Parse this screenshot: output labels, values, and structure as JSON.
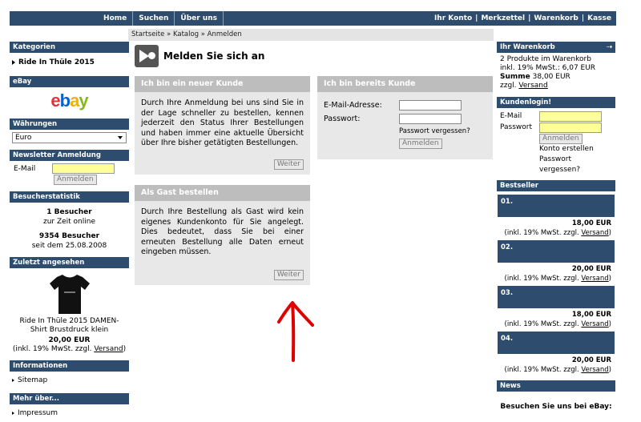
{
  "topnav": {
    "left": [
      "Home",
      "Suchen",
      "Über uns"
    ],
    "right": [
      "Ihr Konto",
      "Merkzettel",
      "Warenkorb",
      "Kasse"
    ]
  },
  "breadcrumb": "Startseite » Katalog » Anmelden",
  "left": {
    "kategorien": {
      "title": "Kategorien",
      "item": "Ride In Thüle 2015"
    },
    "ebay": {
      "title": "eBay",
      "logo": "ebay"
    },
    "waehrungen": {
      "title": "Währungen",
      "selected": "Euro"
    },
    "newsletter": {
      "title": "Newsletter Anmeldung",
      "email_label": "E-Mail",
      "button": "Anmelden"
    },
    "besucher": {
      "title": "Besucherstatistik",
      "online_count": "1 Besucher",
      "online_text": "zur Zeit online",
      "total_count": "9354 Besucher",
      "total_text": "seit dem 25.08.2008"
    },
    "zuletzt": {
      "title": "Zuletzt angesehen",
      "product_name": "Ride In Thüle 2015 DAMEN-Shirt Brustdruck klein",
      "price": "20,00 EUR",
      "tax_prefix": "(inkl. 19% MwSt. zzgl.",
      "tax_link": "Versand",
      "tax_suffix": ")"
    },
    "informationen": {
      "title": "Informationen",
      "item": "Sitemap"
    },
    "mehr": {
      "title": "Mehr über...",
      "item": "Impressum"
    }
  },
  "main": {
    "title": "Melden Sie sich an",
    "new_customer": {
      "title": "Ich bin ein neuer Kunde",
      "text": "Durch Ihre Anmeldung bei uns sind Sie in der Lage schneller zu bestellen, kennen jederzeit den Status Ihrer Bestellungen und haben immer eine aktuelle Übersicht über Ihre bisher getätigten Bestellungen.",
      "button": "Weiter"
    },
    "guest": {
      "title": "Als Gast bestellen",
      "text": "Durch Ihre Bestellung als Gast wird kein eigenes Kundenkonto für Sie angelegt. Dies bedeutet, dass Sie bei einer erneuten Bestellung alle Daten erneut eingeben müssen.",
      "button": "Weiter"
    },
    "existing": {
      "title": "Ich bin bereits Kunde",
      "email_label": "E-Mail-Adresse:",
      "password_label": "Passwort:",
      "forgot": "Passwort vergessen?",
      "button": "Anmelden"
    }
  },
  "right": {
    "warenkorb": {
      "title": "Ihr Warenkorb",
      "count": "2 Produkte im Warenkorb",
      "tax_line": "inkl. 19% MwSt.: 6,07 EUR",
      "sum_label": "Summe",
      "sum_value": "38,00 EUR",
      "shipping_prefix": "zzgl.",
      "shipping_link": "Versand"
    },
    "login": {
      "title": "Kundenlogin!",
      "email_label": "E-Mail",
      "password_label": "Passwort",
      "button": "Anmelden",
      "create": "Konto erstellen",
      "forgot": "Passwort vergessen?"
    },
    "bestseller": {
      "title": "Bestseller",
      "items": [
        {
          "rank": "01.",
          "price": "18,00 EUR"
        },
        {
          "rank": "02.",
          "price": "20,00 EUR"
        },
        {
          "rank": "03.",
          "price": "18,00 EUR"
        },
        {
          "rank": "04.",
          "price": "20,00 EUR"
        }
      ],
      "tax_prefix": "(inkl. 19% MwSt. zzgl.",
      "tax_link": "Versand",
      "tax_suffix": ")"
    },
    "news": {
      "title": "News",
      "text": "Besuchen Sie uns bei eBay:"
    }
  },
  "colors": {
    "header": "#2e4c6d",
    "panel_head": "#bdbdbd",
    "panel_bg": "#e8e8e8",
    "input_yellow": "#ffff99",
    "annotation": "#e00000"
  }
}
